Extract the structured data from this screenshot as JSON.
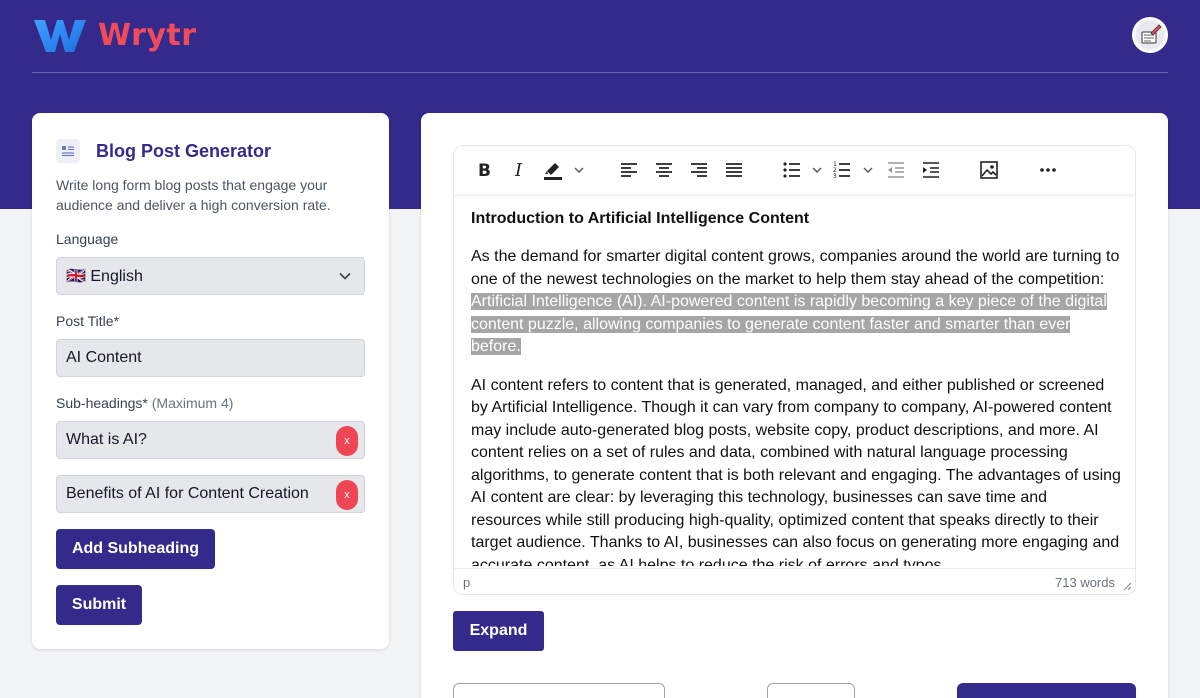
{
  "brand": {
    "name": "Wrytr",
    "logo_letter": "W"
  },
  "tool": {
    "title": "Blog Post Generator",
    "description": "Write long form blog posts that engage your audience and deliver a high conversion rate.",
    "language_label": "Language",
    "language_value": "🇬🇧 English",
    "post_title_label": "Post Title*",
    "post_title_value": "AI Content",
    "subheadings_label": "Sub-headings*",
    "subheadings_hint": "(Maximum 4)",
    "subheadings": [
      "What is AI?",
      "Benefits of AI for Content Creation"
    ],
    "remove_label": "x",
    "add_subheading_label": "Add Subheading",
    "submit_label": "Submit"
  },
  "editor": {
    "heading": "Introduction to Artificial Intelligence Content",
    "p1_start": "As the demand for smarter digital content grows, companies around the world are turning to one of the newest technologies on the market to help them stay ahead of the competition: ",
    "p1_selected": "Artificial Intelligence (AI). AI-powered content is rapidly becoming a key piece of the digital content puzzle, allowing companies to generate content faster and smarter than ever before.",
    "p2": "AI content refers to content that is generated, managed, and either published or screened by Artificial Intelligence. Though it can vary from company to company, AI-powered content may include auto-generated blog posts, website copy, product descriptions, and more. AI content relies on a set of rules and data, combined with natural language processing algorithms, to generate content that is both relevant and engaging. The advantages of using AI content are clear: by leveraging this technology, businesses can save time and resources while still producing high-quality, optimized content that speaks directly to their target audience. Thanks to AI, businesses can also focus on generating more engaging and accurate content, as AI helps to reduce the risk of errors and typos.",
    "status_path": "p",
    "word_count": "713 words",
    "expand_label": "Expand"
  },
  "colors": {
    "brand_bg": "#332a8c",
    "accent_red": "#ef4b5b",
    "selection": "#a6a6a6"
  }
}
